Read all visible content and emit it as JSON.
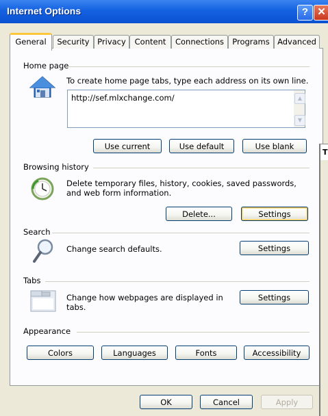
{
  "window": {
    "title": "Internet Options",
    "help_glyph": "?",
    "close_glyph": "✕"
  },
  "tabs": [
    {
      "label": "General",
      "active": true
    },
    {
      "label": "Security"
    },
    {
      "label": "Privacy"
    },
    {
      "label": "Content"
    },
    {
      "label": "Connections"
    },
    {
      "label": "Programs"
    },
    {
      "label": "Advanced"
    }
  ],
  "home_page": {
    "group_label": "Home page",
    "description": "To create home page tabs, type each address on its own line.",
    "url": "http://sef.mlxchange.com/",
    "use_current_label": "Use current",
    "use_default_label": "Use default",
    "use_blank_label": "Use blank"
  },
  "browsing_history": {
    "group_label": "Browsing history",
    "description": "Delete temporary files, history, cookies, saved passwords, and web form information.",
    "delete_label": "Delete...",
    "settings_label": "Settings"
  },
  "search": {
    "group_label": "Search",
    "description": "Change search defaults.",
    "settings_label": "Settings"
  },
  "tabs_section": {
    "group_label": "Tabs",
    "description": "Change how webpages are displayed in tabs.",
    "settings_label": "Settings"
  },
  "appearance": {
    "group_label": "Appearance",
    "colors_label": "Colors",
    "languages_label": "Languages",
    "fonts_label": "Fonts",
    "accessibility_label": "Accessibility"
  },
  "footer": {
    "ok_label": "OK",
    "cancel_label": "Cancel",
    "apply_label": "Apply"
  },
  "background_window": {
    "title_glyph": "T"
  },
  "colors": {
    "titlebar": "#0a52d2",
    "focus_ring": "#f0c050",
    "button_border": "#003c74"
  }
}
